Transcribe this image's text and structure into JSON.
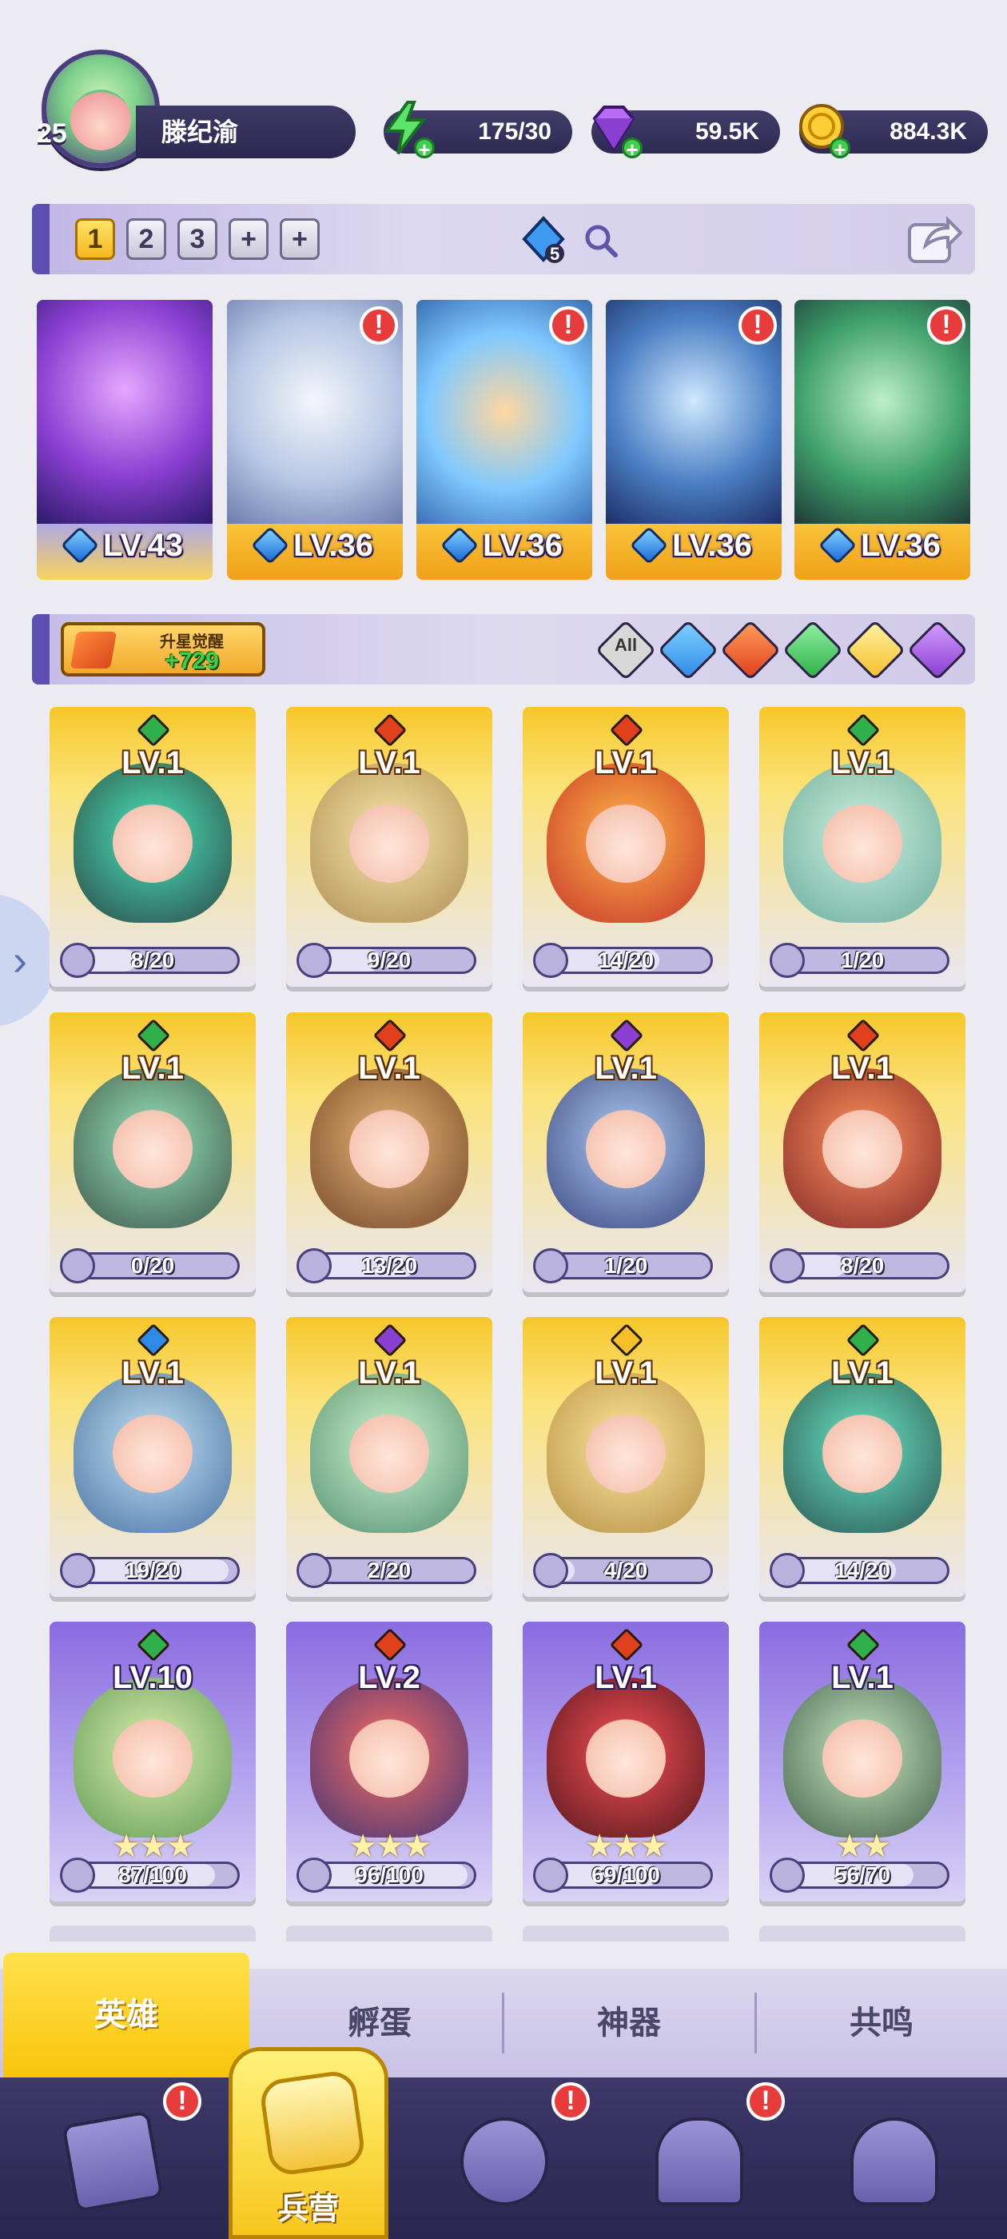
{
  "player": {
    "level": "25",
    "name": "滕纪渝"
  },
  "resources": {
    "energy": "175/30",
    "gems": "59.5K",
    "coins": "884.3K"
  },
  "team": {
    "slots": [
      "1",
      "2",
      "3",
      "+",
      "+"
    ],
    "active_slot": "1",
    "crystal_count": "5"
  },
  "team_heroes": [
    {
      "level": "LV.43",
      "alert": ""
    },
    {
      "level": "LV.36",
      "alert": "!"
    },
    {
      "level": "LV.36",
      "alert": "!"
    },
    {
      "level": "LV.36",
      "alert": "!"
    },
    {
      "level": "LV.36",
      "alert": "!"
    }
  ],
  "filter": {
    "star_awaken_label": "升星觉醒",
    "star_awaken_count": "+729",
    "all_label": "All",
    "elements": [
      "all",
      "water",
      "fire",
      "nature",
      "light",
      "dark"
    ]
  },
  "heroes": [
    {
      "element": "nature",
      "level": "LV.1",
      "progress": "8/20",
      "fraction": 0.4,
      "style": "gold",
      "stars": ""
    },
    {
      "element": "fire",
      "level": "LV.1",
      "progress": "9/20",
      "fraction": 0.45,
      "style": "gold",
      "stars": ""
    },
    {
      "element": "fire",
      "level": "LV.1",
      "progress": "14/20",
      "fraction": 0.7,
      "style": "gold",
      "stars": ""
    },
    {
      "element": "nature",
      "level": "LV.1",
      "progress": "1/20",
      "fraction": 0.05,
      "style": "gold",
      "stars": ""
    },
    {
      "element": "nature",
      "level": "LV.1",
      "progress": "0/20",
      "fraction": 0.0,
      "style": "gold",
      "stars": ""
    },
    {
      "element": "fire",
      "level": "LV.1",
      "progress": "13/20",
      "fraction": 0.65,
      "style": "gold",
      "stars": ""
    },
    {
      "element": "dark",
      "level": "LV.1",
      "progress": "1/20",
      "fraction": 0.05,
      "style": "gold",
      "stars": ""
    },
    {
      "element": "fire",
      "level": "LV.1",
      "progress": "8/20",
      "fraction": 0.4,
      "style": "gold",
      "stars": ""
    },
    {
      "element": "water",
      "level": "LV.1",
      "progress": "19/20",
      "fraction": 0.95,
      "style": "gold",
      "stars": ""
    },
    {
      "element": "dark",
      "level": "LV.1",
      "progress": "2/20",
      "fraction": 0.1,
      "style": "gold",
      "stars": ""
    },
    {
      "element": "light",
      "level": "LV.1",
      "progress": "4/20",
      "fraction": 0.2,
      "style": "gold",
      "stars": ""
    },
    {
      "element": "nature",
      "level": "LV.1",
      "progress": "14/20",
      "fraction": 0.7,
      "style": "gold",
      "stars": ""
    },
    {
      "element": "nature",
      "level": "LV.10",
      "progress": "87/100",
      "fraction": 0.87,
      "style": "purple",
      "stars": "★★★"
    },
    {
      "element": "fire",
      "level": "LV.2",
      "progress": "96/100",
      "fraction": 0.96,
      "style": "purple",
      "stars": "★★★"
    },
    {
      "element": "fire",
      "level": "LV.1",
      "progress": "69/100",
      "fraction": 0.69,
      "style": "purple",
      "stars": "★★★"
    },
    {
      "element": "nature",
      "level": "LV.1",
      "progress": "56/70",
      "fraction": 0.8,
      "style": "purple",
      "stars": "★★"
    }
  ],
  "tabs": {
    "heroes": "英雄",
    "hatch": "孵蛋",
    "artifacts": "神器",
    "resonance": "共鸣"
  },
  "bottom_nav": {
    "barracks": "兵营",
    "alert": "!"
  },
  "colors": {
    "water": "#2e8be6",
    "fire": "#e0401c",
    "nature": "#2fb04a",
    "light": "#f5c02a",
    "dark": "#8a3fd1",
    "all": "#d8d8d8"
  }
}
